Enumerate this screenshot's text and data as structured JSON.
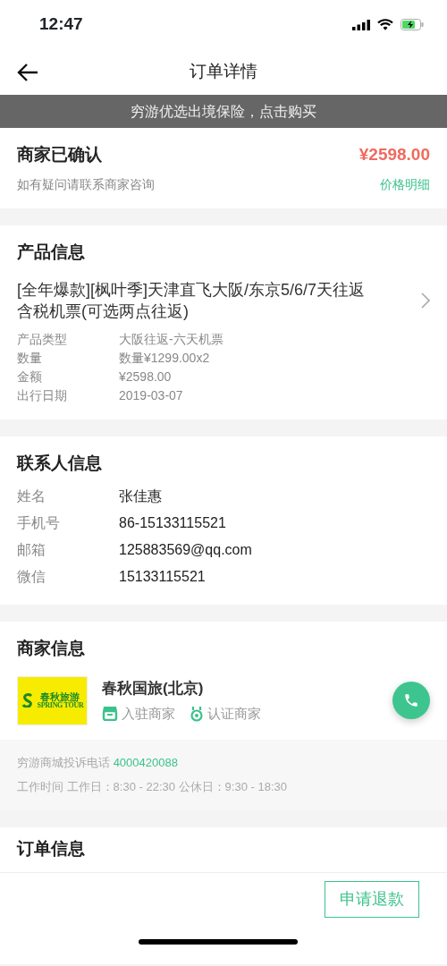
{
  "status_bar": {
    "time": "12:47"
  },
  "nav": {
    "title": "订单详情"
  },
  "banner": {
    "text": "穷游优选出境保险，点击购买"
  },
  "order_status": {
    "title": "商家已确认",
    "price": "¥2598.00",
    "hint": "如有疑问请联系商家咨询",
    "link": "价格明细"
  },
  "product": {
    "heading": "产品信息",
    "name": "[全年爆款][枫叶季]天津直飞大阪/东京5/6/7天往返含税机票(可选两点往返)",
    "rows": [
      {
        "label": "产品类型",
        "value": "大阪往返-六天机票"
      },
      {
        "label": "数量",
        "value": "数量¥1299.00x2"
      },
      {
        "label": "金额",
        "value": "¥2598.00"
      },
      {
        "label": "出行日期",
        "value": "2019-03-07"
      }
    ]
  },
  "contact": {
    "heading": "联系人信息",
    "rows": [
      {
        "label": "姓名",
        "value": "张佳惠"
      },
      {
        "label": "手机号",
        "value": "86-15133115521"
      },
      {
        "label": "邮箱",
        "value": "125883569@qq.com"
      },
      {
        "label": "微信",
        "value": "15133115521"
      }
    ]
  },
  "merchant": {
    "heading": "商家信息",
    "logo": {
      "text": "春秋旅游",
      "subtext": "SPRING TOUR"
    },
    "name": "春秋国旅(北京)",
    "tags": [
      {
        "kind": "store",
        "label": "入驻商家"
      },
      {
        "kind": "certified",
        "label": "认证商家"
      }
    ],
    "complaint_label": "穷游商城投诉电话",
    "complaint_phone": "4000420088",
    "hours": "工作时间 工作日：8:30 - 22:30 公休日：9:30 - 18:30"
  },
  "order_info": {
    "heading": "订单信息"
  },
  "footer": {
    "button": "申请退款"
  }
}
